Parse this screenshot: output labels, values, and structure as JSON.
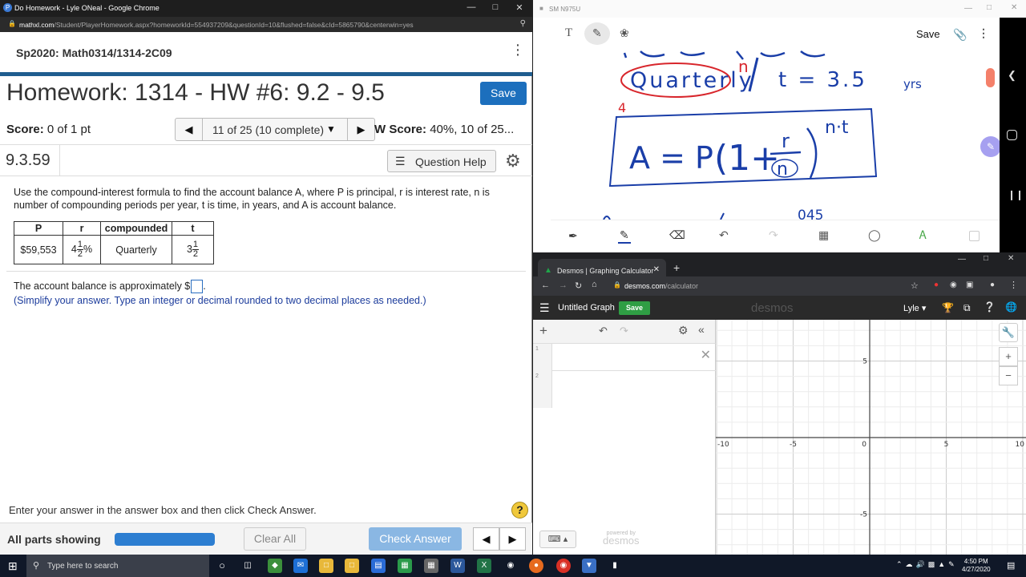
{
  "left_window": {
    "title": "Do Homework - Lyle ONeal - Google Chrome",
    "url_host": "mathxl.com",
    "url_path": "/Student/PlayerHomework.aspx?homeworkId=554937209&questionId=10&flushed=false&cId=5865790&centerwin=yes",
    "course": "Sp2020: Math0314/1314-2C09",
    "hw_title": "Homework: 1314 - HW #6: 9.2 - 9.5",
    "save_label": "Save",
    "score_label": "Score:",
    "score_value": "0 of 1 pt",
    "question_nav_label": "11 of 25 (10 complete)",
    "hw_score_label": "W Score:",
    "hw_score_value": "40%, 10 of 25...",
    "question_number": "9.3.59",
    "question_help_label": "Question Help",
    "question_text": "Use the compound-interest formula to find the account balance A, where P is principal, r is interest rate, n is number of compounding periods per year, t is time, in years, and A is account balance.",
    "table": {
      "headers": [
        "P",
        "r",
        "compounded",
        "t"
      ],
      "P": "$59,553",
      "r_whole": "4",
      "r_num": "1",
      "r_den": "2",
      "r_suffix": "%",
      "compounded": "Quarterly",
      "t_whole": "3",
      "t_num": "1",
      "t_den": "2"
    },
    "answer_prefix": "The account balance is approximately $",
    "answer_suffix": ".",
    "answer_value": "",
    "hint": "(Simplify your answer. Type an integer or decimal rounded to two decimal places as needed.)",
    "footer_instruction": "Enter your answer in the answer box and then click Check Answer.",
    "help_label": "?",
    "all_parts_label": "All parts showing",
    "progress_fraction": 1.0,
    "clear_all_label": "Clear All",
    "check_answer_label": "Check Answer"
  },
  "notes_window": {
    "title": "SM N975U",
    "save_label": "Save",
    "handwriting": {
      "word": "Quarterly",
      "n_mark": "n",
      "t_eq": "t = 3.5",
      "yrs": "yrs",
      "four": "4",
      "formula_lhs": "A = P",
      "formula_paren": "(1+",
      "formula_r": "r",
      "formula_n": "n",
      "exponent": "n·t",
      "bottom_partial": "045"
    }
  },
  "desmos_window": {
    "tab_title": "Desmos | Graphing Calculator",
    "url_host": "desmos.com",
    "url_path": "/calculator",
    "graph_title": "Untitled Graph",
    "save_label": "Save",
    "logo": "desmos",
    "user": "Lyle",
    "expr_line_1": "1",
    "expr_line_2": "2",
    "powered_small": "powered by",
    "powered_big": "desmos",
    "x_ticks": [
      "-10",
      "-5",
      "0",
      "5",
      "10"
    ],
    "y_ticks": [
      "5",
      "-5"
    ]
  },
  "taskbar": {
    "search_placeholder": "Type here to search",
    "time": "4:50 PM",
    "date": "4/27/2020"
  },
  "colors": {
    "mathxl_blue": "#1c6fbd",
    "header_rule": "#1f5d8f",
    "ink_blue": "#1a3ea8",
    "ink_red": "#d8262c",
    "desmos_green": "#2f9e44"
  }
}
